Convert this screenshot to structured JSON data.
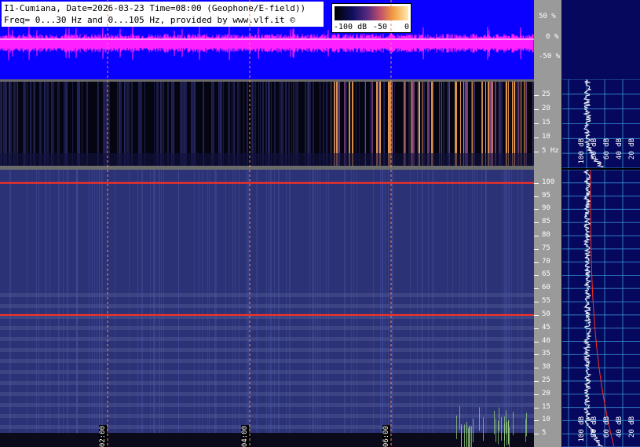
{
  "header": {
    "line1": "I1-Cumiana, Date=2026-03-23 Time=08:00 (Geophone/E-field))",
    "line2": "Freq= 0...30 Hz and 0...105 Hz, provided by www.vlf.it ©"
  },
  "db_scale": {
    "labels": [
      "-100 dB",
      "-50",
      "0"
    ]
  },
  "waveform_axis": {
    "labels": [
      "50 %",
      "0 %",
      "-50 %"
    ]
  },
  "colors": {
    "wave_bg": "#0a00ff",
    "wave_signal": "#ff20ff",
    "line_red": "#ff3020",
    "grid_cyan": "#40a8e8",
    "spec_bg": "#06085e"
  },
  "chart_data": [
    {
      "type": "heatmap",
      "title": "",
      "yticks": [
        5,
        10,
        15,
        20,
        25
      ],
      "ytick_labels": [
        "5 Hz",
        "10",
        "15",
        "20",
        "25"
      ],
      "ylim": [
        0,
        30
      ]
    },
    {
      "type": "heatmap",
      "title": "",
      "yticks": [
        5,
        10,
        15,
        20,
        25,
        30,
        35,
        40,
        45,
        50,
        55,
        60,
        65,
        70,
        75,
        80,
        85,
        90,
        95,
        100
      ],
      "ylim": [
        0,
        105
      ],
      "lines_hz": [
        50,
        100
      ]
    },
    {
      "type": "line",
      "x_time_labels": [
        "02:00",
        "04:00",
        "06:00"
      ]
    }
  ],
  "spectrum_labels_top": [
    "100 dB",
    "80 dB",
    "60 dB",
    "40 dB",
    "20 dB"
  ],
  "spectrum_labels_bottom": [
    "100 dB",
    "80 dB",
    "60 dB",
    "40 dB",
    "20 dB"
  ]
}
